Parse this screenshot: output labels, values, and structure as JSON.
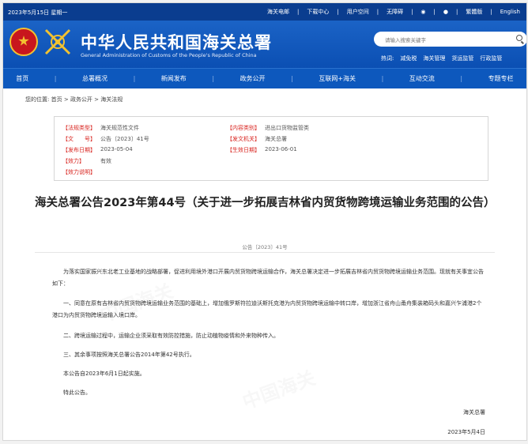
{
  "topbar": {
    "date": "2023年5月15日 星期一",
    "links": [
      "海关电邮",
      "下载中心",
      "用户空间",
      "无障碍",
      "繁體版",
      "English"
    ]
  },
  "header": {
    "title_cn": "中华人民共和国海关总署",
    "title_en": "General Administration of Customs of the People's Republic of China",
    "search_placeholder": "请输入搜索关键字",
    "hot_label": "热词:",
    "hot_words": [
      "减免税",
      "海关管理",
      "货运监管",
      "行政监管"
    ]
  },
  "nav": [
    "首页",
    "总署概况",
    "新闻发布",
    "政务公开",
    "互联网+海关",
    "互动交流",
    "专题专栏"
  ],
  "breadcrumb": {
    "prefix": "您的位置:",
    "items": [
      "首页",
      "政务公开",
      "海关法规"
    ],
    "sep": ">"
  },
  "info": {
    "type_label": "【法规类型】",
    "type_value": "海关规范性文件",
    "content_label": "【内容类别】",
    "content_value": "进出口货物监管类",
    "num_label": "【文　　号】",
    "num_value": "公告〔2023〕41号",
    "issuer_label": "【发文机关】",
    "issuer_value": "海关总署",
    "issue_date_label": "【发布日期】",
    "issue_date_value": "2023-05-04",
    "effective_label": "【生效日期】",
    "effective_value": "2023-06-01",
    "validity_label": "【效力】",
    "validity_value": "有效",
    "note_label": "【效力说明】"
  },
  "article": {
    "title": "海关总署公告2023年第44号（关于进一步拓展吉林省内贸货物跨境运输业务范围的公告）",
    "doc_number": "公告〔2023〕41号",
    "paragraphs": [
      "为落实国家振兴东北老工业基地的战略部署，促进利用境外港口开展内贸货物跨境运输合作，海关总署决定进一步拓展吉林省内贸货物跨境运输业务范围。现就有关事宜公告如下：",
      "一、同意在原有吉林省内贸货物跨境运输业务范围的基础上，增加俄罗斯符拉迪沃斯托克港为内贸货物跨境运输中转口岸，增加浙江省舟山甬舟集装箱码头和嘉兴乍浦港2个港口为内贸货物跨境运输入境口岸。",
      "二、跨境运输过程中，运输企业须采取有效防控措施，防止动植物疫情和外来物种传入。",
      "三、其余事项按照海关总署公告2014年第42号执行。",
      "本公告自2023年6月1日起实施。",
      "特此公告。"
    ],
    "signature": "海关总署",
    "sign_date": "2023年5月4日"
  },
  "colors": {
    "primary": "#0d58bd",
    "topbar": "#0a3d8f",
    "label_red": "#d8221d"
  }
}
